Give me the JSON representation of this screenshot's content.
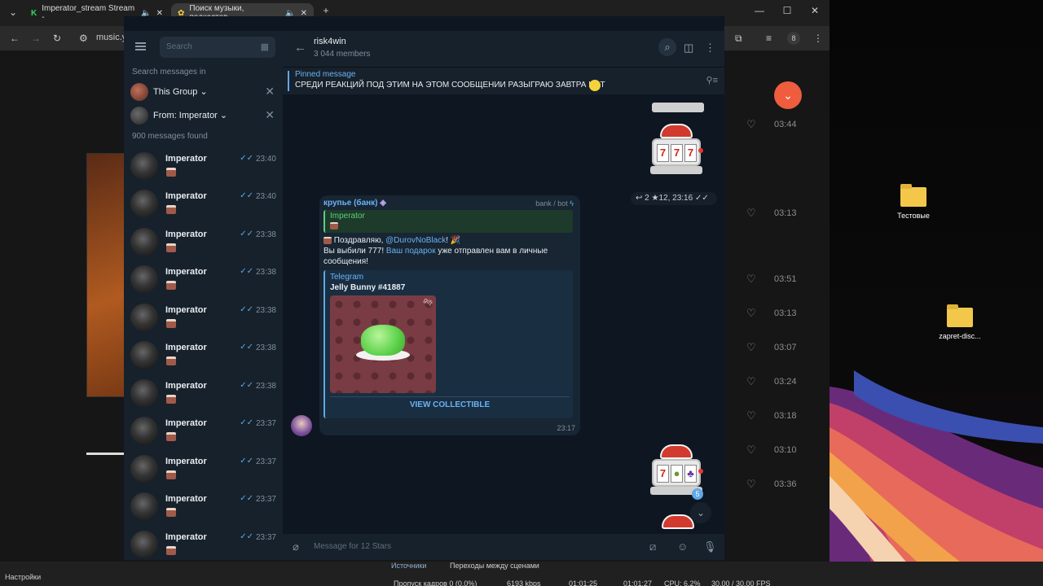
{
  "browser": {
    "tabs": [
      {
        "label": "Imperator_stream Stream -"
      },
      {
        "label": "Поиск музыки, подкастов"
      }
    ],
    "new_tab": "+",
    "address_partial": "music.y",
    "profile_badge": "8"
  },
  "music": {
    "durations": [
      "03:44",
      "03:13",
      "03:51",
      "03:13",
      "03:07",
      "03:24",
      "03:18",
      "03:10",
      "03:36"
    ]
  },
  "desktop": {
    "icons": [
      {
        "label": "Тестовые"
      },
      {
        "label": "zapret-disc..."
      }
    ]
  },
  "telegram": {
    "search": {
      "placeholder": "Search"
    },
    "search_in_label": "Search messages in",
    "scope": "This Group",
    "from": "From: Imperator",
    "found": "900 messages found",
    "results": [
      {
        "name": "Imperator",
        "time": "23:40"
      },
      {
        "name": "Imperator",
        "time": "23:40"
      },
      {
        "name": "Imperator",
        "time": "23:38"
      },
      {
        "name": "Imperator",
        "time": "23:38"
      },
      {
        "name": "Imperator",
        "time": "23:38"
      },
      {
        "name": "Imperator",
        "time": "23:38"
      },
      {
        "name": "Imperator",
        "time": "23:38"
      },
      {
        "name": "Imperator",
        "time": "23:37"
      },
      {
        "name": "Imperator",
        "time": "23:37"
      },
      {
        "name": "Imperator",
        "time": "23:37"
      },
      {
        "name": "Imperator",
        "time": "23:37"
      }
    ],
    "chat": {
      "title": "risk4win",
      "members": "3 044 members",
      "pinned_label": "Pinned message",
      "pinned_text": "СРЕДИ РЕАКЦИЙ ПОД ЭТИМ НА ЭТОМ СООБЩЕНИИ РАЗЫГРАЮ ЗАВТРА НФТ",
      "slot_meta": "↩ 2  ★12, 23:16 ✓✓",
      "message": {
        "sender": "крупье (банк)",
        "via": "bank / bot",
        "reply_name": "Imperator",
        "text_1": "Поздравляю, ",
        "mention": "@DurovNoBlack",
        "text_2": "! 🎉",
        "text_3": "Вы выбили 777! ",
        "gift_link": "Ваш подарок",
        "text_4": " уже отправлен вам в личные сообщения!",
        "preview_site": "Telegram",
        "preview_title": "Jelly Bunny #41887",
        "gift_tag": "gift",
        "preview_button": "VIEW COLLECTIBLE",
        "time": "23:17"
      },
      "unread_badge": "5",
      "composer_placeholder": "Message for 12 Stars"
    }
  },
  "taskbar": {
    "settings": "Настройки",
    "items": [
      {
        "label": "Источники"
      },
      {
        "label": "Переходы между сценами"
      }
    ],
    "status": [
      {
        "label": "Пропуск кадров 0 (0.0%)"
      },
      {
        "label": "6193 kbps"
      },
      {
        "label": "01:01:25"
      },
      {
        "label": "01:01:27"
      },
      {
        "label": "CPU: 6.2%"
      },
      {
        "label": "30.00 / 30.00 FPS"
      }
    ]
  }
}
